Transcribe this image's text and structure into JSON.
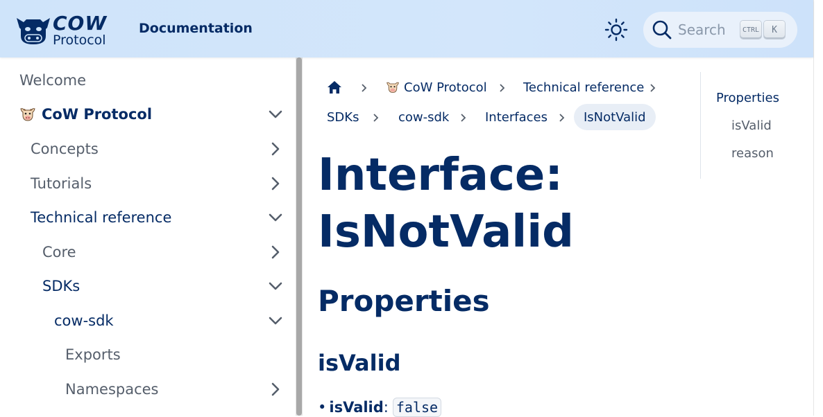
{
  "navbar": {
    "logo_word": "COW",
    "logo_sub": "Protocol",
    "title": "Documentation",
    "theme_toggle_icon": "sun-icon",
    "search": {
      "placeholder": "Search",
      "shortcut_ctrl": "CTRL",
      "shortcut_key": "K"
    }
  },
  "sidebar": {
    "items": [
      {
        "label": "Welcome",
        "icon": null,
        "chevron": null
      },
      {
        "label": "CoW Protocol",
        "icon": "cow-emoji-icon",
        "chevron": "down"
      },
      {
        "label": "Concepts",
        "icon": null,
        "chevron": "right"
      },
      {
        "label": "Tutorials",
        "icon": null,
        "chevron": "right"
      },
      {
        "label": "Technical reference",
        "icon": null,
        "chevron": "down"
      },
      {
        "label": "Core",
        "icon": null,
        "chevron": "right"
      },
      {
        "label": "SDKs",
        "icon": null,
        "chevron": "down"
      },
      {
        "label": "cow-sdk",
        "icon": null,
        "chevron": "down"
      },
      {
        "label": "Exports",
        "icon": null,
        "chevron": null
      },
      {
        "label": "Namespaces",
        "icon": null,
        "chevron": "right"
      }
    ]
  },
  "breadcrumbs": {
    "home_icon": "home-icon",
    "items": [
      "CoW Protocol",
      "Technical reference",
      "SDKs",
      "cow-sdk",
      "Interfaces",
      "IsNotValid"
    ]
  },
  "content": {
    "title_line1": "Interface:",
    "title_line2": "IsNotValid",
    "section": "Properties",
    "property": "isValid",
    "bullet_name": "isValid",
    "bullet_sep": ":",
    "bullet_value": "false"
  },
  "toc": {
    "items": [
      {
        "label": "Properties"
      },
      {
        "label": "isValid"
      },
      {
        "label": "reason"
      }
    ]
  },
  "colors": {
    "primary": "#052b65",
    "navbar_bg": "#cfe4fa",
    "muted_text": "#555e6b"
  }
}
